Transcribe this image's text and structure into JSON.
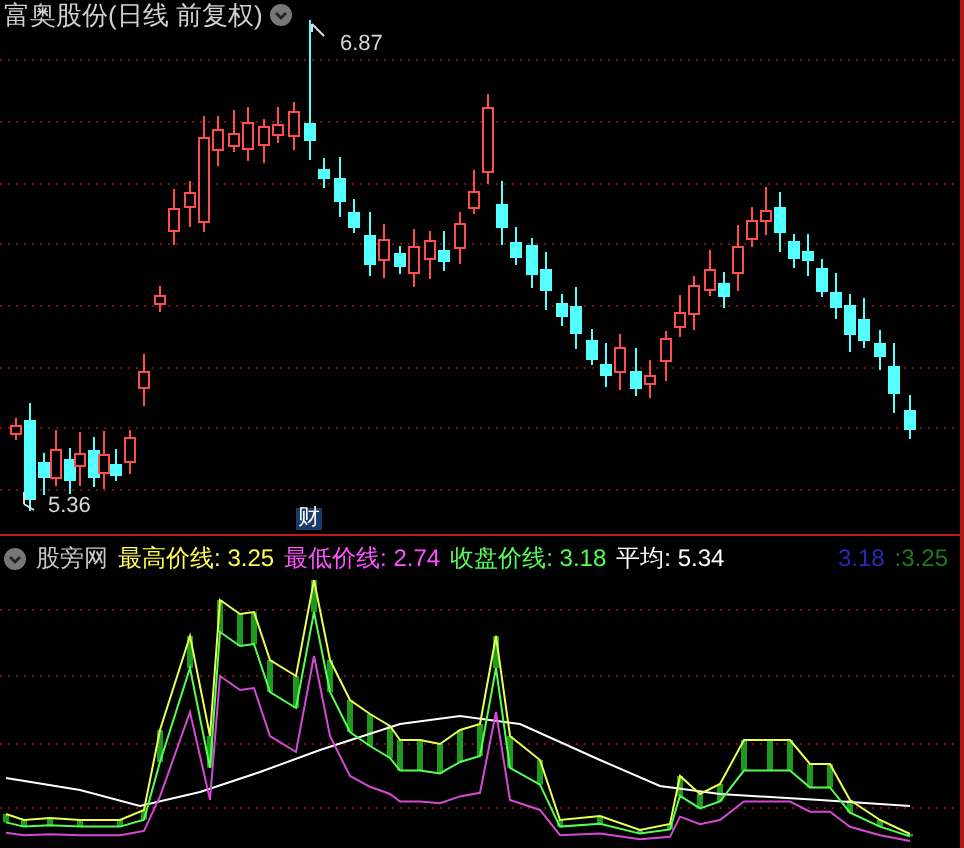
{
  "chart_title": "富奥股份(日线 前复权)",
  "price_chart": {
    "high_label": "6.87",
    "low_label": "5.36",
    "event_marker": "财"
  },
  "indicator": {
    "name": "股旁网",
    "legend": [
      {
        "label": "最高价线:",
        "value": "3.25",
        "color": "#ffff54"
      },
      {
        "label": "最低价线:",
        "value": "2.74",
        "color": "#ff54ff"
      },
      {
        "label": "收盘价线:",
        "value": "3.18",
        "color": "#54ff54"
      },
      {
        "label": "平均:",
        "value": "5.34",
        "color": "#ffffff"
      }
    ],
    "extra_values": [
      {
        "value": "3.18",
        "color": "#2a2ab8"
      },
      {
        "value": ":3.25",
        "color": "#1f7a1f"
      }
    ]
  }
}
